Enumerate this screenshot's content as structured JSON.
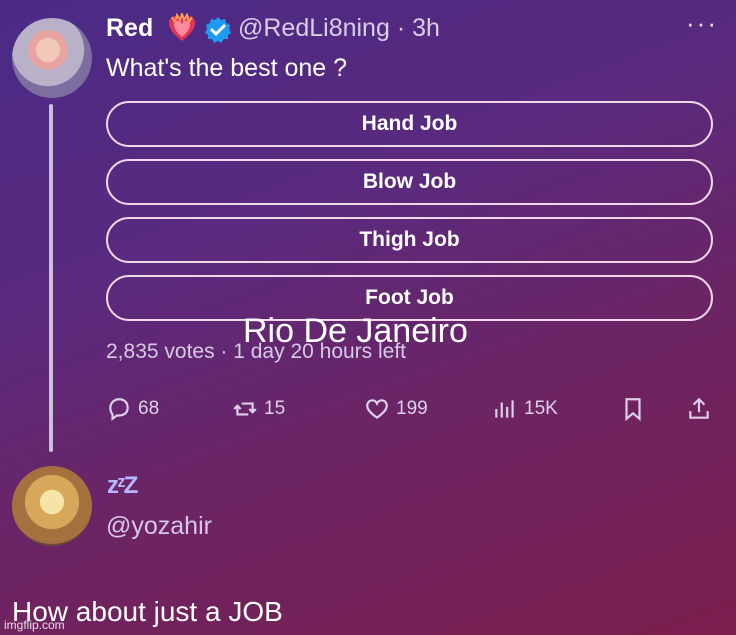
{
  "tweet": {
    "display_name": "Red",
    "handle_time": "@RedLi8ning · 3h",
    "question": "What's the best one ?",
    "poll_options": [
      "Hand Job",
      "Blow Job",
      "Thigh Job",
      "Foot Job"
    ],
    "poll_meta": "2,835 votes · 1 day 20 hours left",
    "actions": {
      "replies": "68",
      "retweets": "15",
      "likes": "199",
      "views": "15K"
    }
  },
  "overlay_text": "Rio De Janeiro",
  "reply": {
    "status_emoji": "zᶻZ",
    "handle": "@yozahir"
  },
  "caption": "How about just a JOB",
  "watermark": "imgflip.com",
  "colors": {
    "accent_verified": "#1d9bf0",
    "bg_top": "#4a2a86",
    "bg_bottom": "#7a1e4c"
  }
}
